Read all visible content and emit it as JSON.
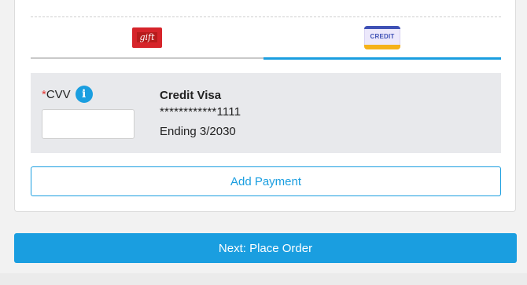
{
  "tabs": {
    "gift": {
      "icon_text": "gift",
      "icon": "gift-card-icon"
    },
    "credit": {
      "icon_text": "CREDIT",
      "icon": "credit-card-icon",
      "active": true
    }
  },
  "payment_card": {
    "cvv_required_mark": "*",
    "cvv_label": "CVV",
    "info_icon_glyph": "i",
    "cvv_value": "",
    "card_name": "Credit Visa",
    "card_number": "************1111",
    "card_expiry": "Ending 3/2030"
  },
  "buttons": {
    "add_payment": "Add Payment",
    "next": "Next: Place Order"
  },
  "colors": {
    "accent": "#1a9ee0",
    "required": "#e53935",
    "gift_red": "#d6242a"
  }
}
